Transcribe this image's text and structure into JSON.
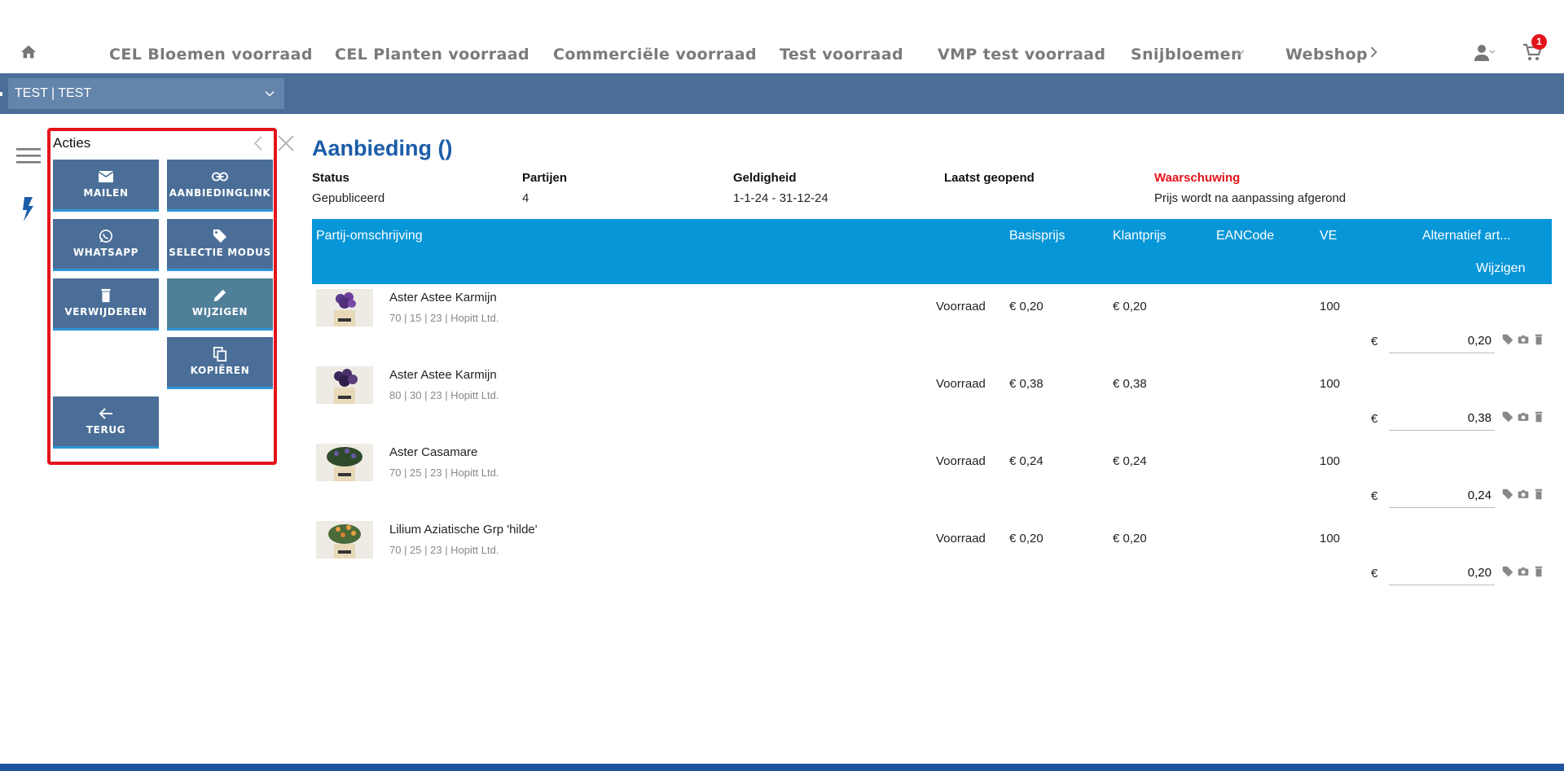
{
  "nav": {
    "items": [
      "CEL Bloemen voorraad",
      "CEL Planten voorraad",
      "Commerciële voorraad",
      "Test voorraad",
      "VMP test voorraad",
      "Snijbloemen",
      "Webshop"
    ],
    "cart_count": "1"
  },
  "selector": {
    "value": "TEST | TEST"
  },
  "actions": {
    "title": "Acties",
    "buttons": [
      "MAILEN",
      "AANBIEDINGLINK",
      "WHATSAPP",
      "SELECTIE MODUS",
      "VERWIJDEREN",
      "WIJZIGEN",
      "KOPIËREN",
      "TERUG"
    ]
  },
  "page": {
    "title": "Aanbieding ()",
    "meta": {
      "status_label": "Status",
      "status_value": "Gepubliceerd",
      "partijen_label": "Partijen",
      "partijen_value": "4",
      "geldigheid_label": "Geldigheid",
      "geldigheid_value": "1-1-24 - 31-12-24",
      "laatst_label": "Laatst geopend",
      "waarschuwing_label": "Waarschuwing",
      "waarschuwing_value": "Prijs wordt na aanpassing afgerond"
    }
  },
  "table": {
    "headers": {
      "omschrijving": "Partij-omschrijving",
      "basisprijs": "Basisprijs",
      "klantprijs": "Klantprijs",
      "eancode": "EANCode",
      "ve": "VE",
      "alternatief": "Alternatief art...",
      "wijzigen": "Wijzigen"
    },
    "currency": "€",
    "rows": [
      {
        "name": "Aster Astee Karmijn",
        "sub": "70 | 15 | 23 | Hopitt Ltd.",
        "type": "Voorraad",
        "basis": "€ 0,20",
        "klant": "€ 0,20",
        "ve": "100",
        "input": "0,20"
      },
      {
        "name": "Aster Astee Karmijn",
        "sub": "80 | 30 | 23 | Hopitt Ltd.",
        "type": "Voorraad",
        "basis": "€ 0,38",
        "klant": "€ 0,38",
        "ve": "100",
        "input": "0,38"
      },
      {
        "name": "Aster Casamare",
        "sub": "70 | 25 | 23 | Hopitt Ltd.",
        "type": "Voorraad",
        "basis": "€ 0,24",
        "klant": "€ 0,24",
        "ve": "100",
        "input": "0,24"
      },
      {
        "name": "Lilium Aziatische Grp 'hilde'",
        "sub": "70 | 25 | 23 | Hopitt Ltd.",
        "type": "Voorraad",
        "basis": "€ 0,20",
        "klant": "€ 0,20",
        "ve": "100",
        "input": "0,20"
      }
    ]
  },
  "colors": {
    "accent_blue": "#4a6e98",
    "header_blue": "#0796d8",
    "title_blue": "#1c5ca8",
    "warning_red": "#e3131b",
    "highlight_red": "#e3131b"
  },
  "icons": [
    "home-icon",
    "chevron-down-icon",
    "chevron-right-icon",
    "user-icon",
    "cart-icon",
    "menu-icon",
    "flash-icon",
    "chevron-left-icon",
    "close-icon",
    "mail-icon",
    "link-icon",
    "whatsapp-icon",
    "tag-icon",
    "trash-icon",
    "pencil-icon",
    "copy-icon",
    "arrow-left-icon",
    "camera-icon"
  ]
}
